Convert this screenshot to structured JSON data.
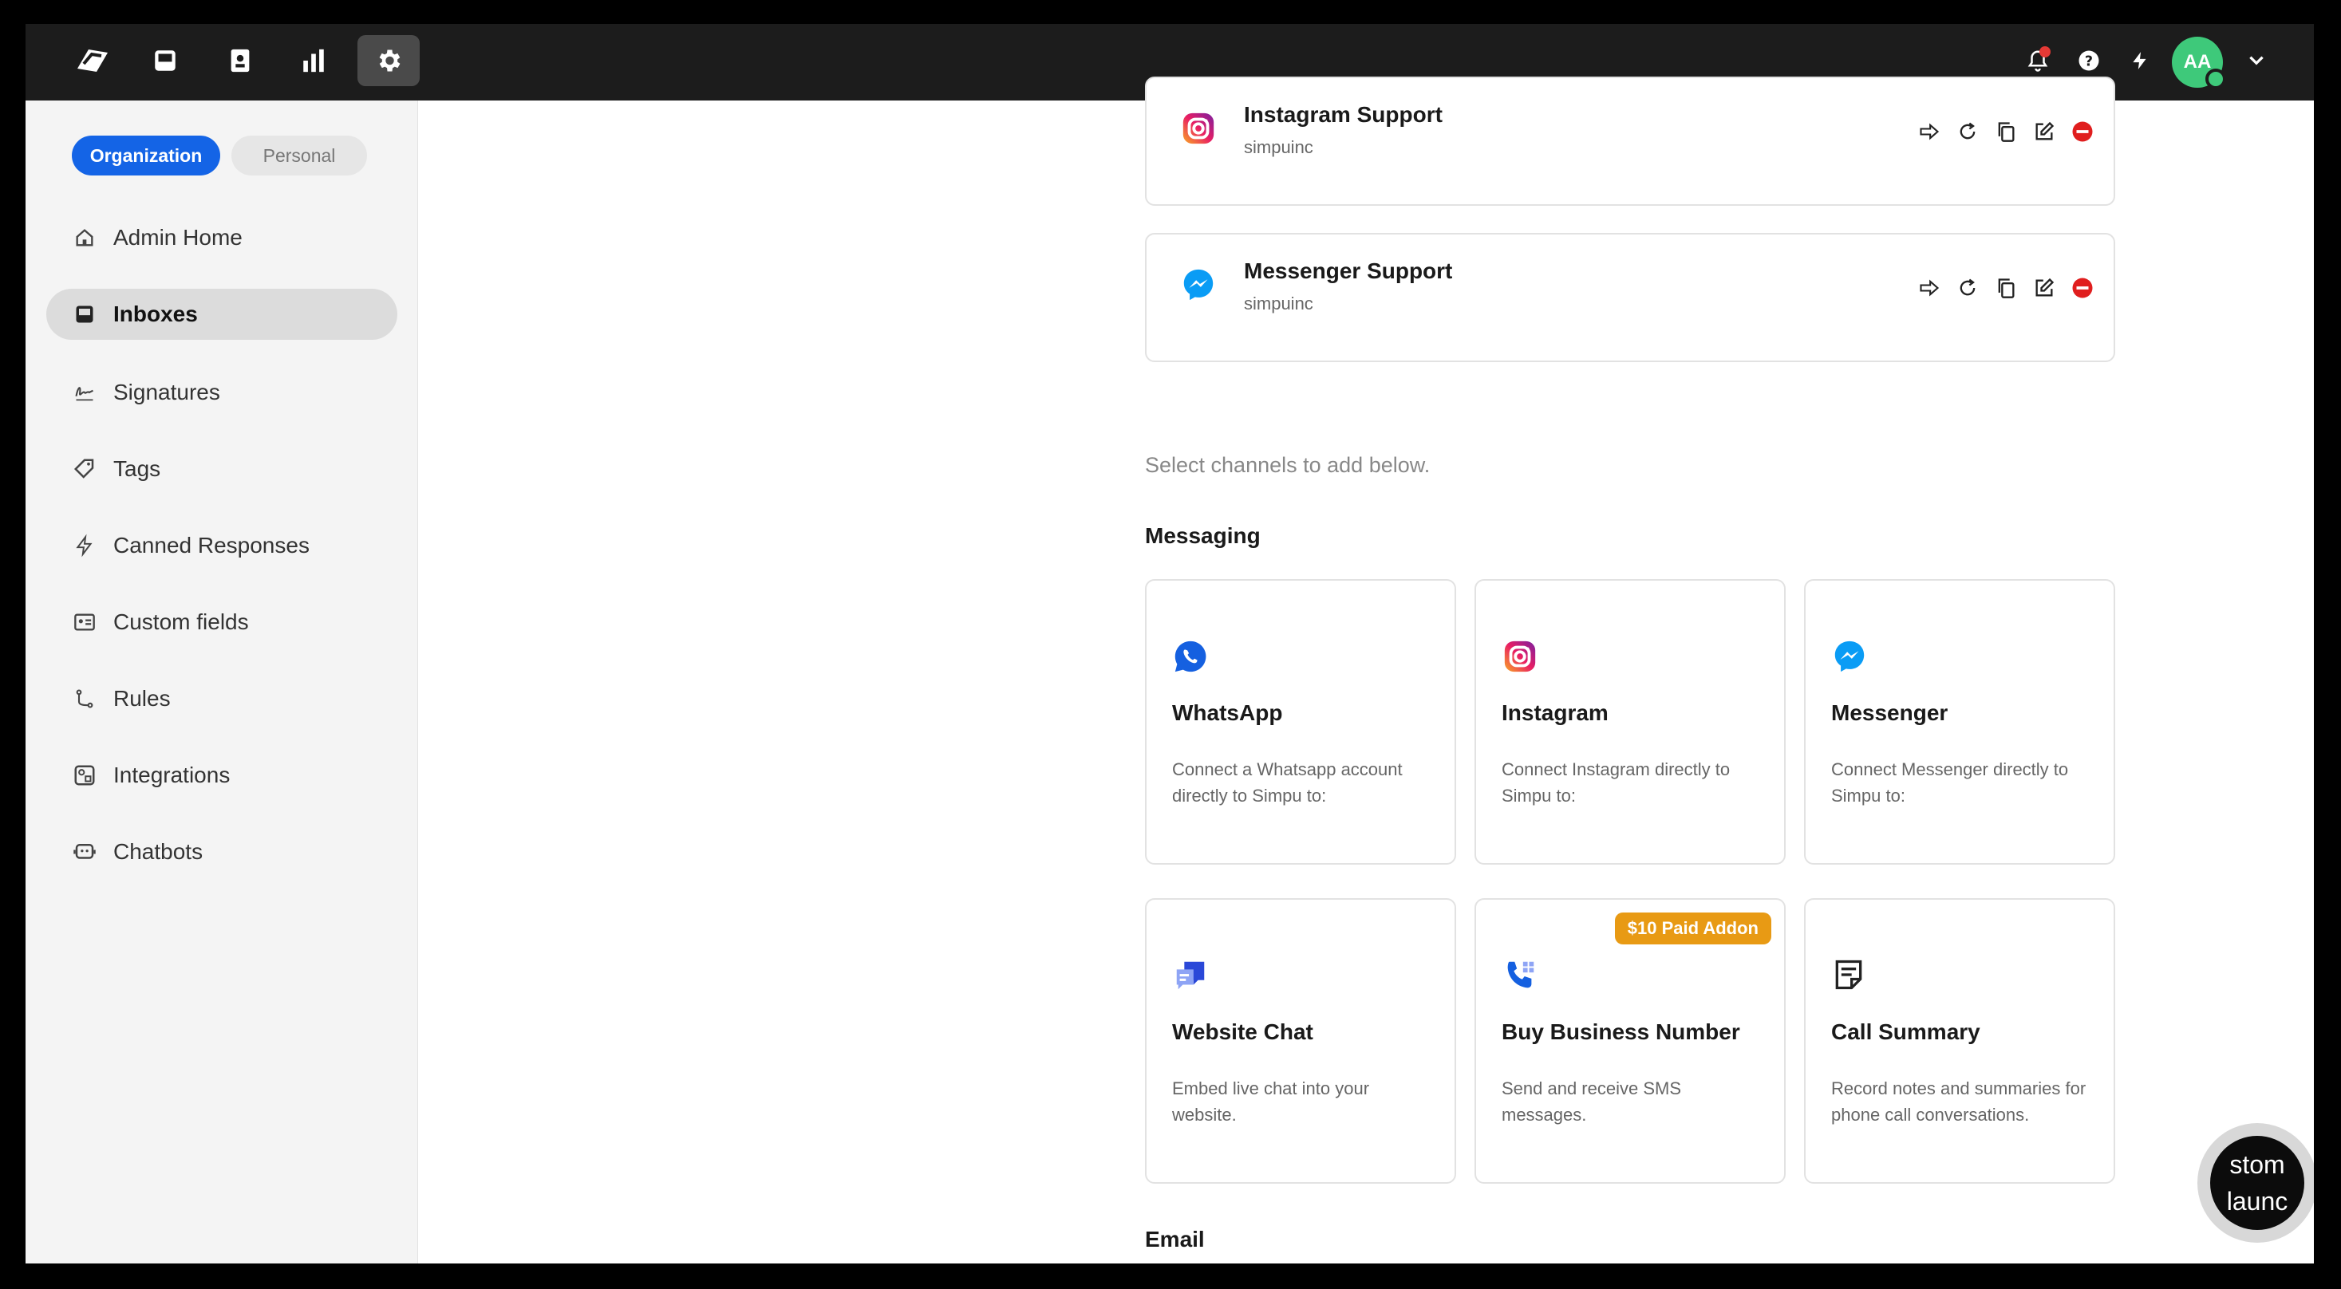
{
  "topbar": {
    "avatar_initials": "AA",
    "nav": [
      {
        "icon": "logo-icon"
      },
      {
        "icon": "inbox-icon"
      },
      {
        "icon": "contacts-icon"
      },
      {
        "icon": "analytics-icon"
      },
      {
        "icon": "settings-icon",
        "active": true
      }
    ],
    "right_icons": [
      "bell-icon",
      "help-icon",
      "bolt-icon",
      "chevron-down-icon"
    ]
  },
  "sidebar": {
    "segment": {
      "organization": "Organization",
      "personal": "Personal"
    },
    "items": [
      {
        "label": "Admin Home",
        "icon": "home-icon"
      },
      {
        "label": "Inboxes",
        "icon": "inbox-icon",
        "active": true
      },
      {
        "label": "Signatures",
        "icon": "signature-icon"
      },
      {
        "label": "Tags",
        "icon": "tag-icon"
      },
      {
        "label": "Canned Responses",
        "icon": "bolt-icon"
      },
      {
        "label": "Custom fields",
        "icon": "id-card-icon"
      },
      {
        "label": "Rules",
        "icon": "rules-icon"
      },
      {
        "label": "Integrations",
        "icon": "integrations-icon"
      },
      {
        "label": "Chatbots",
        "icon": "chatbot-icon"
      }
    ]
  },
  "main": {
    "accounts": [
      {
        "name": "Instagram Support",
        "handle": "simpuinc",
        "icon": "instagram-icon"
      },
      {
        "name": "Messenger Support",
        "handle": "simpuinc",
        "icon": "messenger-icon"
      }
    ],
    "hint": "Select channels to add below.",
    "sections": {
      "messaging": "Messaging",
      "email": "Email"
    },
    "channels": [
      {
        "title": "WhatsApp",
        "desc": "Connect a Whatsapp account directly to Simpu to:",
        "icon": "whatsapp-icon"
      },
      {
        "title": "Instagram",
        "desc": "Connect Instagram directly to Simpu to:",
        "icon": "instagram-icon"
      },
      {
        "title": "Messenger",
        "desc": "Connect Messenger directly to Simpu to:",
        "icon": "messenger-icon"
      },
      {
        "title": "Website Chat",
        "desc": "Embed live chat into your website.",
        "icon": "website-chat-icon"
      },
      {
        "title": "Buy Business Number",
        "desc": "Send and receive SMS messages.",
        "icon": "phone-icon",
        "badge": "$10 Paid Addon"
      },
      {
        "title": "Call Summary",
        "desc": "Record notes and summaries for phone call conversations.",
        "icon": "notes-icon"
      }
    ]
  },
  "launcher": {
    "line1": "stom",
    "line2": "launc"
  },
  "colors": {
    "primary": "#1464e6",
    "topbar": "#1c1c1c",
    "badge": "#e89a14",
    "danger": "#e01e1e",
    "online": "#3ec97a"
  }
}
